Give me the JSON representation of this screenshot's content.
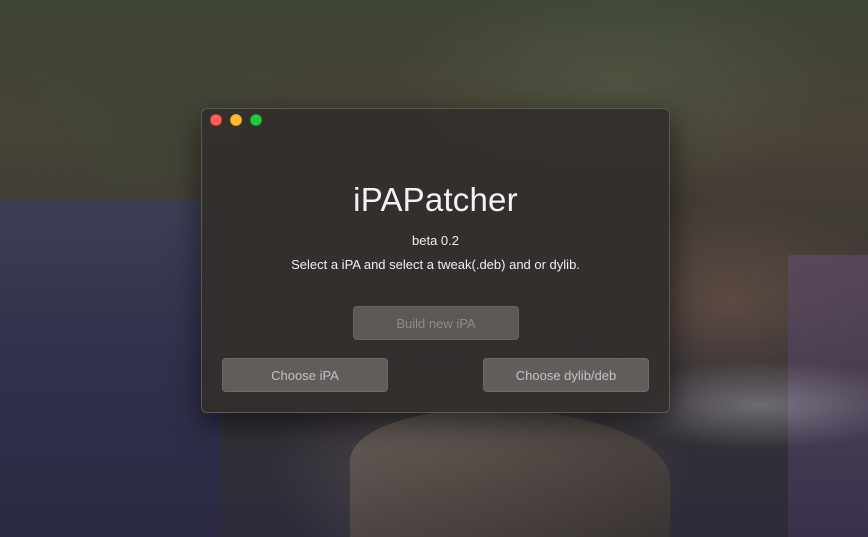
{
  "window": {
    "controls": {
      "close": {
        "icon": "close-icon",
        "color": "#fe5f57"
      },
      "minimize": {
        "icon": "minimize-icon",
        "color": "#febc2e"
      },
      "zoom": {
        "icon": "zoom-icon",
        "color": "#28c840"
      }
    }
  },
  "app": {
    "title": "iPAPatcher",
    "version": "beta 0.2",
    "instructions": "Select a iPA and select a tweak(.deb) and or dylib."
  },
  "buttons": {
    "build": {
      "label": "Build new iPA",
      "enabled": false
    },
    "choose_ipa": {
      "label": "Choose iPA",
      "enabled": true
    },
    "choose_dylib": {
      "label": "Choose dylib/deb",
      "enabled": true
    }
  }
}
